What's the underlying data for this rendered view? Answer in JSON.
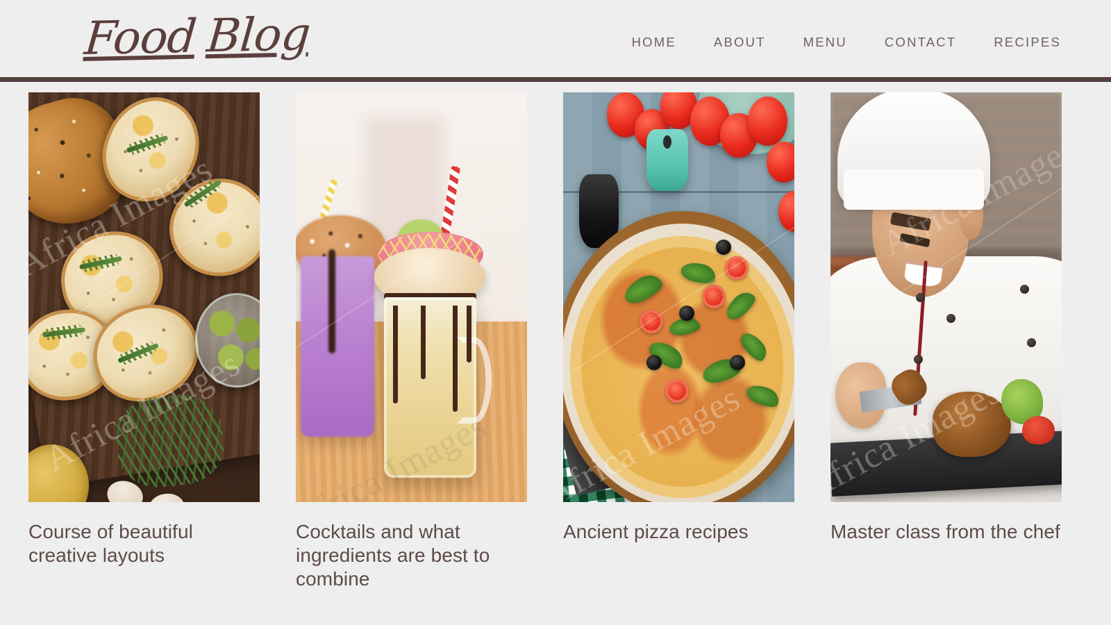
{
  "site": {
    "logo_text_1": "Food",
    "logo_text_2": "Blog",
    "background_color": "#eeeeee",
    "rule_color": "#53413f",
    "accent_color": "#5b3f3d",
    "nav_color": "#70605f",
    "title_color": "#5d4b49"
  },
  "nav": {
    "items": [
      {
        "label": "HOME"
      },
      {
        "label": "ABOUT"
      },
      {
        "label": "MENU"
      },
      {
        "label": "CONTACT"
      },
      {
        "label": "RECIPES"
      }
    ]
  },
  "cards": [
    {
      "title": "Course of beautiful creative layouts",
      "image_alt": "Toasted bruschetta slices with rosemary on a dark wooden board, olives, olive oil and garlic"
    },
    {
      "title": "Cocktails and what ingredients are best to combine",
      "image_alt": "Two mason jar milkshakes topped with donuts, macaron and striped paper straws on a wooden table"
    },
    {
      "title": "Ancient pizza recipes",
      "image_alt": "Pizza with basil, black olives and tomatoes on a wooden board over a blue table with green checkered cloth"
    },
    {
      "title": "Master class from the chef",
      "image_alt": "Smiling chef in white uniform and toque plating grilled meat with tongs on a slate board"
    }
  ],
  "watermark": {
    "text": "Africa Images"
  }
}
